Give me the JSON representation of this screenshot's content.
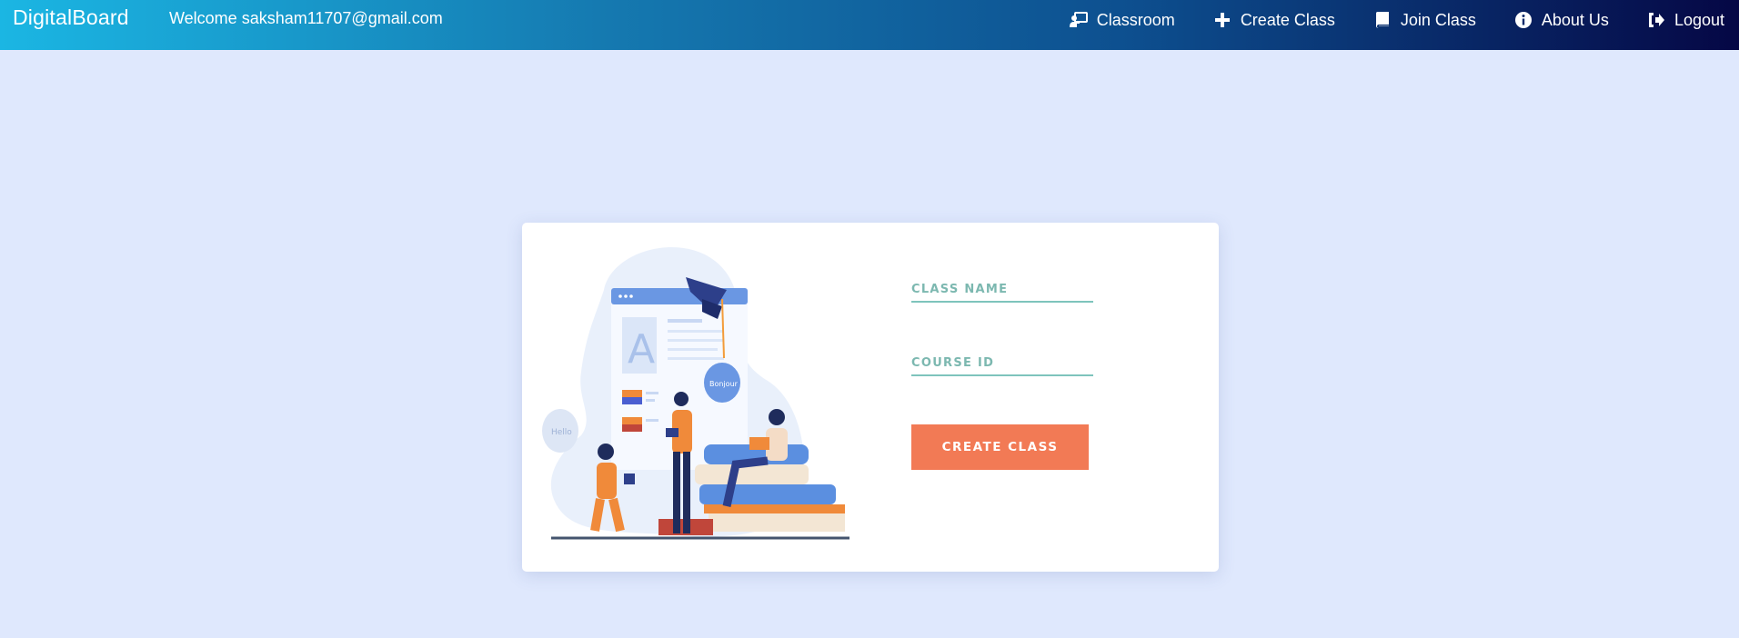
{
  "navbar": {
    "brand": "DigitalBoard",
    "welcome": "Welcome saksham11707@gmail.com",
    "links": [
      {
        "label": "Classroom",
        "icon": "chalkboard-teacher-icon"
      },
      {
        "label": "Create Class",
        "icon": "plus-icon"
      },
      {
        "label": "Join Class",
        "icon": "book-icon"
      },
      {
        "label": "About Us",
        "icon": "info-circle-icon"
      },
      {
        "label": "Logout",
        "icon": "sign-out-icon"
      }
    ]
  },
  "form": {
    "class_name_placeholder": "CLASS NAME",
    "course_id_placeholder": "COURSE ID",
    "submit_label": "CREATE CLASS"
  },
  "colors": {
    "nav_gradient_start": "#1bb6e3",
    "nav_gradient_end": "#050745",
    "page_bg": "#dfe8fd",
    "accent_button": "#f27a55",
    "field_underline": "#7ec4bc"
  }
}
